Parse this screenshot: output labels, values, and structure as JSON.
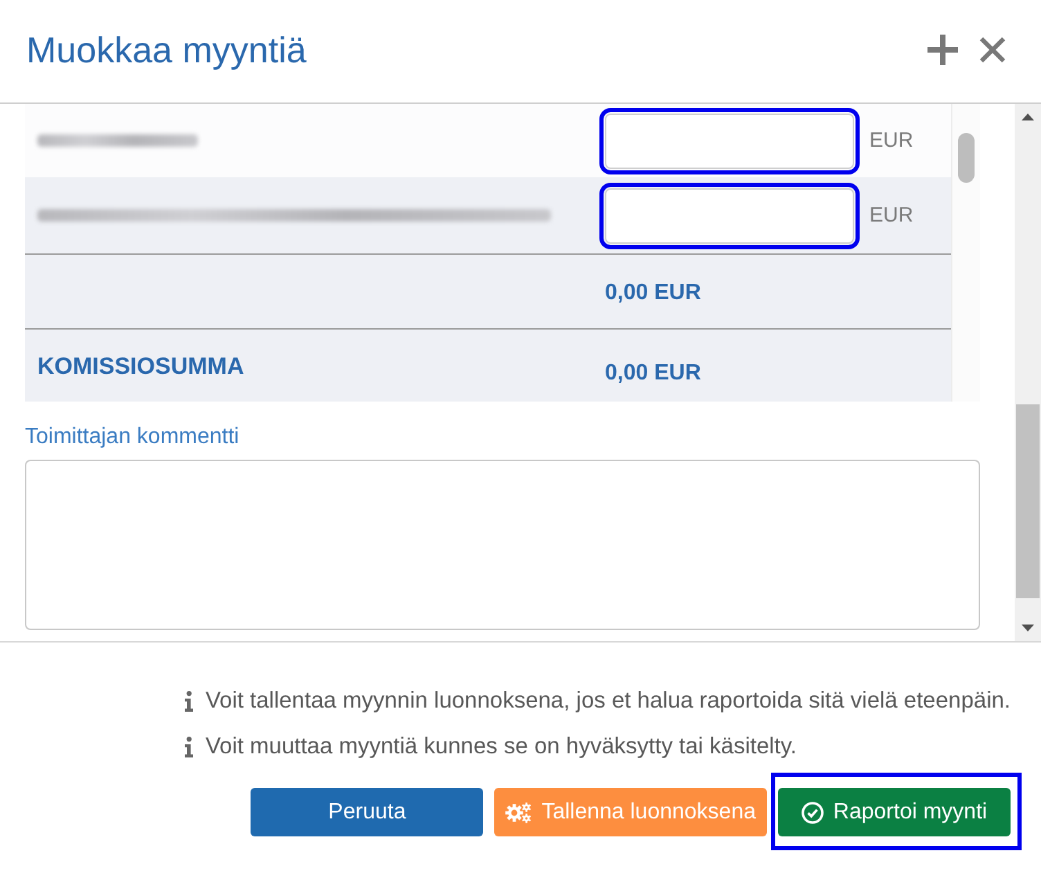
{
  "dialog": {
    "title": "Muokkaa myyntiä"
  },
  "rows": [
    {
      "kind": "input",
      "label": {
        "kind": "blurred_short"
      },
      "unit": "EUR",
      "highlighted": true
    },
    {
      "kind": "input",
      "label": {
        "kind": "blurred_long"
      },
      "unit": "EUR",
      "highlighted": true
    },
    {
      "kind": "total",
      "amount": "0,00 EUR"
    },
    {
      "kind": "total",
      "label": {
        "kind": "text",
        "text": "KOMISSIOSUMMA"
      },
      "amount": "0,00 EUR"
    }
  ],
  "comment": {
    "label": "Toimittajan kommentti"
  },
  "notes": [
    "Voit tallentaa myynnin luonnoksena, jos et halua raportoida sitä vielä eteenpäin.",
    "Voit muuttaa myyntiä kunnes se on hyväksytty tai käsitelty."
  ],
  "buttons": [
    {
      "kind": "cancel",
      "label": "Peruuta",
      "highlighted": false
    },
    {
      "kind": "save_draft",
      "label": "Tallenna luonnoksena",
      "highlighted": false
    },
    {
      "kind": "submit",
      "label": "Raportoi myynti",
      "highlighted": true
    }
  ]
}
